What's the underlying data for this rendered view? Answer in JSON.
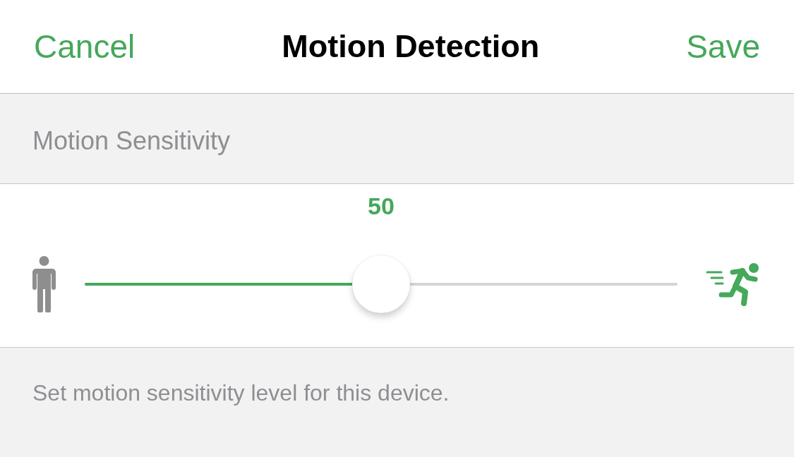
{
  "nav": {
    "cancel": "Cancel",
    "title": "Motion Detection",
    "save": "Save"
  },
  "section": {
    "header": "Motion Sensitivity"
  },
  "slider": {
    "value": "50",
    "level": 0.5
  },
  "footer": "Set motion sensitivity level for this device."
}
